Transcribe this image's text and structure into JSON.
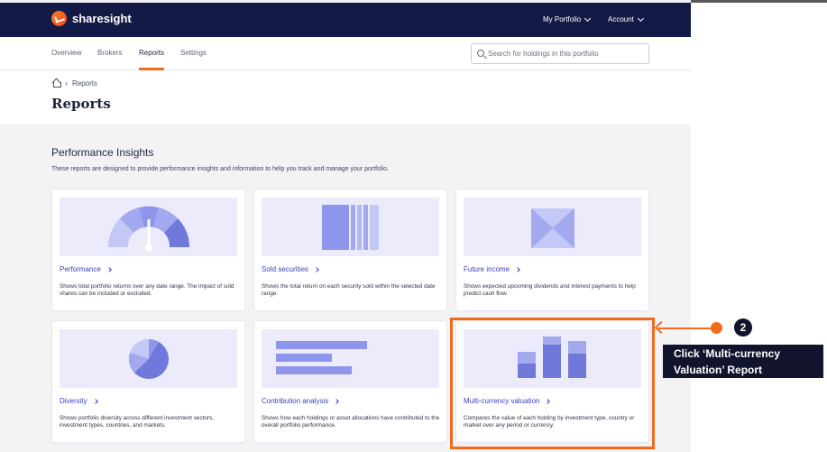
{
  "app": {
    "logo_text": "sharesight"
  },
  "navbar": {
    "portfolio_menu": "My Portfolio",
    "account_menu": "Account"
  },
  "tabs": [
    {
      "label": "Overview"
    },
    {
      "label": "Brokers"
    },
    {
      "label": "Reports",
      "active": true
    },
    {
      "label": "Settings"
    }
  ],
  "search": {
    "placeholder": "Search for holdings in this portfolio"
  },
  "breadcrumb": {
    "current": "Reports"
  },
  "page": {
    "title": "Reports"
  },
  "section": {
    "title": "Performance Insights",
    "description": "These reports are designed to provide performance insights and information to help you track and manage your portfolio."
  },
  "cards": [
    {
      "title": "Performance",
      "description": "Shows total portfolio returns over any date range. The impact of sold shares can be included or excluded.",
      "illustration": "gauge"
    },
    {
      "title": "Sold securities",
      "description": "Shows the total return on each security sold within the selected date range.",
      "illustration": "stripes"
    },
    {
      "title": "Future income",
      "description": "Shows expected upcoming dividends and interest payments to help predict cash flow.",
      "illustration": "envelope"
    },
    {
      "title": "Diversity",
      "description": "Shows portfolio diversity across different investment sectors, investment types, countries, and markets.",
      "illustration": "pie"
    },
    {
      "title": "Contribution analysis",
      "description": "Shows how each holdings or asset allocations have contributed to the overall portfolio performance.",
      "illustration": "horizontal-bars"
    },
    {
      "title": "Multi-currency valuation",
      "description": "Compares the value of each holding by investment type, country or market over any period or currency.",
      "illustration": "stacked-bars"
    }
  ],
  "annotation": {
    "step": "2",
    "tooltip": "Click ‘Multi-currency Valuation’ Report"
  },
  "colors": {
    "navbar": "#141a46",
    "accent": "#f26b1d",
    "link": "#3d3fb8",
    "illustration_bg": "#ebebfb"
  }
}
